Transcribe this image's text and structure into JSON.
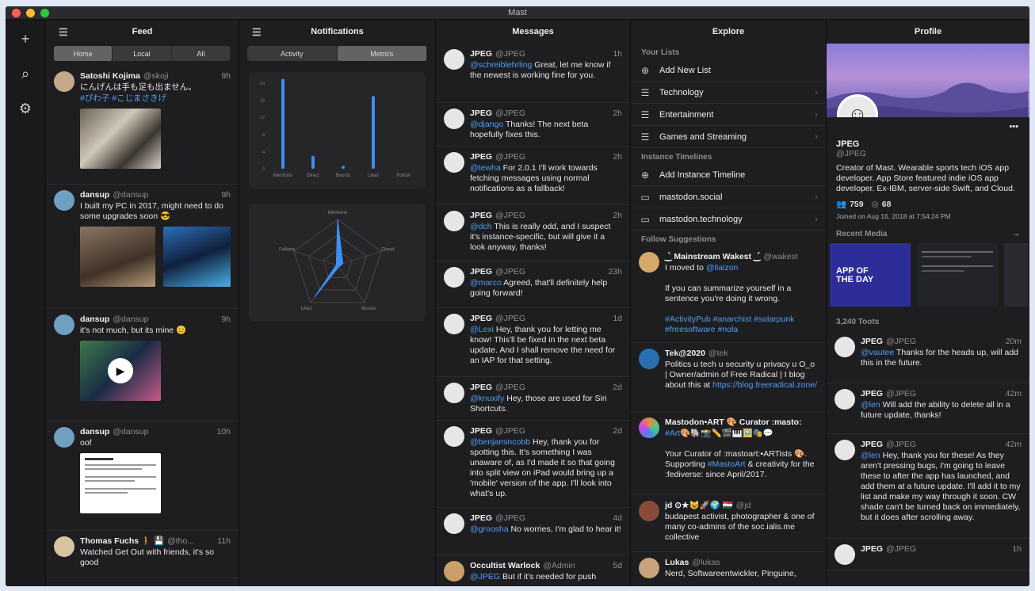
{
  "app": {
    "title": "Mast"
  },
  "rail": {
    "compose": "+",
    "search": "⌕",
    "settings": "⚙"
  },
  "feed": {
    "title": "Feed",
    "tabs": [
      "Home",
      "Local",
      "All"
    ],
    "posts": [
      {
        "name": "Satoshi Kojima",
        "handle": "@skoji",
        "time": "9h",
        "text": "にんげんは手も足も出ません。",
        "tags": "#ぴわ子 #こじまさきげ"
      },
      {
        "name": "dansup",
        "handle": "@dansup",
        "time": "9h",
        "text": "I built my PC in 2017, might need to do some upgrades soon 😎"
      },
      {
        "name": "dansup",
        "handle": "@dansup",
        "time": "9h",
        "text": "it's not much, but its mine 😊"
      },
      {
        "name": "dansup",
        "handle": "@dansup",
        "time": "10h",
        "text": "oof"
      },
      {
        "name": "Thomas Fuchs 🚶 💾",
        "handle": "@tho...",
        "time": "11h",
        "text": "Watched Get Out with friends, it's so good"
      }
    ]
  },
  "notifications": {
    "title": "Notifications",
    "tabs": [
      "Activity",
      "Metrics"
    ],
    "bar_ticks": [
      "20",
      "16",
      "12",
      "8",
      "4",
      "0"
    ],
    "radar_labels": [
      "Mentions",
      "Direct",
      "Boosts",
      "Likes",
      "Follows"
    ]
  },
  "chart_data": {
    "type": "bar",
    "categories": [
      "Mentions",
      "Direct",
      "Boosts",
      "Likes",
      "Follow"
    ],
    "values": [
      21,
      3,
      0.7,
      17,
      0
    ],
    "ylim": [
      0,
      20
    ]
  },
  "messages": {
    "title": "Messages",
    "items": [
      {
        "name": "JPEG",
        "handle": "@JPEG",
        "time": "1h",
        "mention": "@schreiblehrling",
        "text": " Great, let me know if the newest is working fine for you."
      },
      {
        "name": "JPEG",
        "handle": "@JPEG",
        "time": "2h",
        "mention": "@django",
        "text": " Thanks! The next beta hopefully fixes this."
      },
      {
        "name": "JPEG",
        "handle": "@JPEG",
        "time": "2h",
        "mention": "@tewha",
        "text": " For 2.0.1 I'll work towards fetching messages using normal notifications as a fallback!"
      },
      {
        "name": "JPEG",
        "handle": "@JPEG",
        "time": "2h",
        "mention": "@dch",
        "text": " This is really odd, and I suspect it's instance-specific, but will give it a look anyway, thanks!"
      },
      {
        "name": "JPEG",
        "handle": "@JPEG",
        "time": "23h",
        "mention": "@marco",
        "text": " Agreed, that'll definitely help going forward!"
      },
      {
        "name": "JPEG",
        "handle": "@JPEG",
        "time": "1d",
        "mention": "@Lexi",
        "text": " Hey, thank you for letting me know! This'll be fixed in the next beta update. And I shall remove the need for an IAP for that setting."
      },
      {
        "name": "JPEG",
        "handle": "@JPEG",
        "time": "2d",
        "mention": "@knuxify",
        "text": " Hey, those are used for Siri Shortcuts."
      },
      {
        "name": "JPEG",
        "handle": "@JPEG",
        "time": "2d",
        "mention": "@benjamincobb",
        "text": " Hey, thank you for spotting this. It's something I was unaware of, as I'd made it so that going into split view on iPad would bring up a 'mobile' version of the app. I'll look into what's up."
      },
      {
        "name": "JPEG",
        "handle": "@JPEG",
        "time": "4d",
        "mention": "@groosha",
        "text": " No worries, I'm glad to hear it!"
      },
      {
        "name": "Occultist Warlock",
        "handle": "@Admin",
        "time": "5d",
        "mention": "@JPEG",
        "text": " But if it's needed for push"
      }
    ]
  },
  "explore": {
    "title": "Explore",
    "lists_header": "Your Lists",
    "add_list": "Add New List",
    "lists": [
      "Technology",
      "Entertainment",
      "Games and Streaming"
    ],
    "timelines_header": "Instance Timelines",
    "add_timeline": "Add Instance Timeline",
    "instances": [
      "mastodon.social",
      "mastodon.technology"
    ],
    "suggest_header": "Follow Suggestions",
    "suggestions": [
      {
        "name": "‿̀ Mainstream Wakest ‿́",
        "handle": "@wakest",
        "l1": "I moved to ",
        "l1link": "@liaizon",
        "l2": "If you can summarize yourself in a sentence you're doing it wrong.",
        "tags": "#ActivityPub #anarchist #solarpunk #freesoftware #nola"
      },
      {
        "name": "Tek@2020",
        "handle": "@tek",
        "l1": "Politics u tech u security u privacy u O_o | Owner/admin of Free Radical | I blog about this at ",
        "l1link": "https://blog.freeradical.zone/"
      },
      {
        "name": "Mastodon•ART 🎨 Curator :masto:",
        "handle": "",
        "l1": "",
        "l1link": "#Art",
        "l1b": "🎨🐘📸✏️🎬🎹🖼️🎭💬",
        "l2": "Your Curator of :mastoart:•ARTists 🎨. Supporting ",
        "l2link": "#MastoArt",
        "l2b": " & creativity for the :fediverse: since April/2017."
      },
      {
        "name": "jd ⊙★😺🚀🌍 🇭🇺",
        "handle": "@jd",
        "l1": "budapest activist, photographer & one of many co-admins of the soc.ialis.me collective"
      },
      {
        "name": "Lukas",
        "handle": "@lukas",
        "l1": "Nerd, Softwareentwickler, Pinguine,"
      }
    ]
  },
  "profile": {
    "title": "Profile",
    "name": "JPEG",
    "handle": "@JPEG",
    "more": "•••",
    "bio": "Creator of Mast. Wearable sports tech iOS app developer. App Store featured indie iOS app developer. Ex-IBM, server-side Swift, and Cloud.",
    "following": "759",
    "followers": "68",
    "joined": "Joined on Aug 16, 2018 at 7:54:24 PM",
    "recent_media": "Recent Media",
    "toots": "3,240 Toots",
    "appoftheday": "APP OF THE DAY",
    "posts": [
      {
        "name": "JPEG",
        "handle": "@JPEG",
        "time": "20m",
        "mention": "@vautee",
        "text": " Thanks for the heads up, will add this in the future."
      },
      {
        "name": "JPEG",
        "handle": "@JPEG",
        "time": "42m",
        "mention": "@len",
        "text": " Will add the ability to delete all in a future update, thanks!"
      },
      {
        "name": "JPEG",
        "handle": "@JPEG",
        "time": "42m",
        "mention": "@len",
        "text": " Hey, thank you for these! As they aren't pressing bugs, I'm going to leave these to after the app has launched, and add them at a future update. I'll add it to my list and make my way through it soon. CW shade can't be turned back on immediately, but it does after scrolling away."
      },
      {
        "name": "JPEG",
        "handle": "@JPEG",
        "time": "1h",
        "mention": "",
        "text": ""
      }
    ]
  },
  "colors": {
    "link": "#4e9df5",
    "bar": "#3f8ef2",
    "bg": "#1e1e20"
  }
}
